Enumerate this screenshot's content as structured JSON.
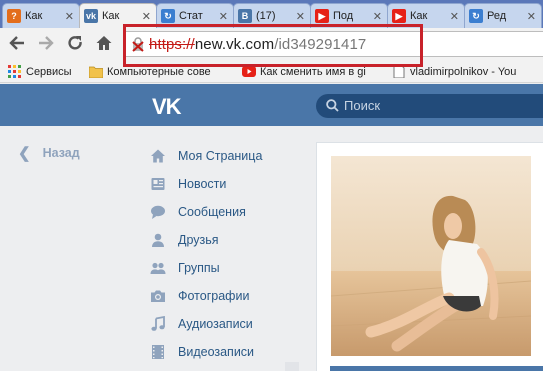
{
  "browser": {
    "tabs": [
      {
        "icon": "question-icon",
        "color": "#e36d1c",
        "label": "Как"
      },
      {
        "icon": "vk-icon",
        "color": "#4a76a8",
        "label": "Как"
      },
      {
        "icon": "zoom-icon",
        "color": "#3b7ed0",
        "label": "Стат"
      },
      {
        "icon": "vk-b-icon",
        "color": "#4a76a8",
        "label": "(17)"
      },
      {
        "icon": "youtube-icon",
        "color": "#e62117",
        "label": "Под"
      },
      {
        "icon": "youtube-icon",
        "color": "#e62117",
        "label": "Как"
      },
      {
        "icon": "zoom-icon",
        "color": "#3b7ed0",
        "label": "Ред"
      }
    ],
    "url": {
      "scheme": "https://",
      "host": "new.vk.com",
      "path": "/id349291417"
    },
    "bookmarks": [
      {
        "icon": "apps-grid-icon",
        "label": "Сервисы"
      },
      {
        "icon": "folder-icon",
        "label": "Компьютерные сове"
      },
      {
        "icon": "youtube-icon",
        "label": "Как сменить имя в gi"
      },
      {
        "icon": "page-icon",
        "label": "vladimirpolnikov - You"
      }
    ]
  },
  "vk": {
    "logo": "VK",
    "search_placeholder": "Поиск",
    "back_label": "Назад",
    "menu": [
      {
        "icon": "home-icon",
        "label": "Моя Страница"
      },
      {
        "icon": "news-icon",
        "label": "Новости"
      },
      {
        "icon": "messages-icon",
        "label": "Сообщения"
      },
      {
        "icon": "friends-icon",
        "label": "Друзья"
      },
      {
        "icon": "groups-icon",
        "label": "Группы"
      },
      {
        "icon": "camera-icon",
        "label": "Фотографии"
      },
      {
        "icon": "music-icon",
        "label": "Аудиозаписи"
      },
      {
        "icon": "video-icon",
        "label": "Видеозаписи"
      }
    ]
  },
  "colors": {
    "vk_blue": "#4a76a8",
    "link_blue": "#2a5885",
    "highlight_red": "#c8222a"
  }
}
